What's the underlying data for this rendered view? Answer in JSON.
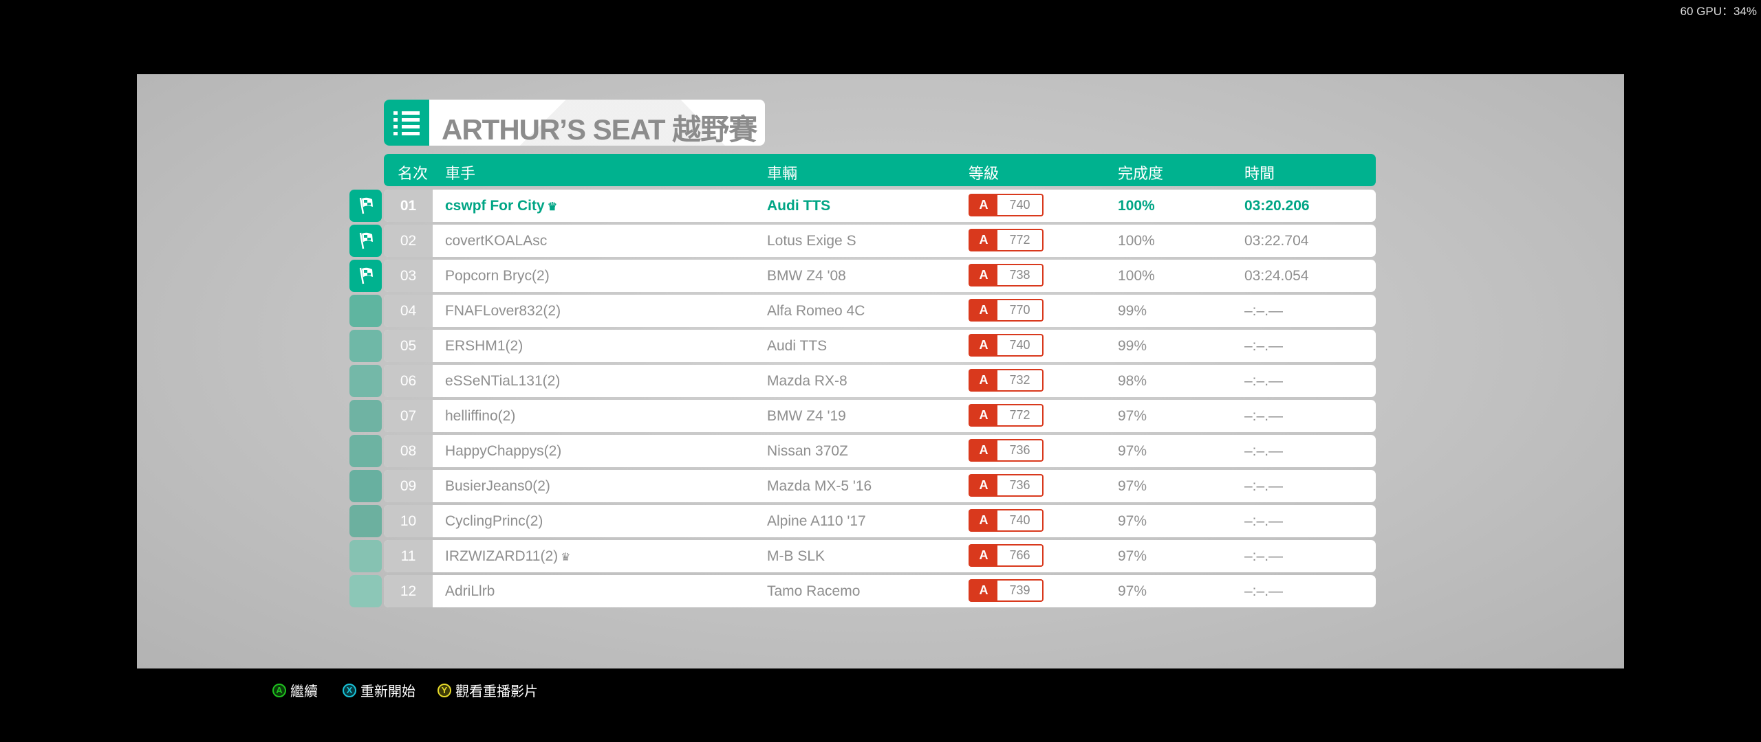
{
  "overlay": {
    "fps": "60 GPU：34%"
  },
  "event": {
    "title": "ARTHUR’S SEAT 越野賽"
  },
  "columns": {
    "rank": "名次",
    "driver": "車手",
    "car": "車輛",
    "class": "等級",
    "completion": "完成度",
    "time": "時間"
  },
  "colors": {
    "accent": "#00b28f",
    "class_a": "#d9391d"
  },
  "rows": [
    {
      "rank": "01",
      "driver": "cswpf For City",
      "crown": true,
      "car": "Audi TTS",
      "cls": "A",
      "pi": "740",
      "completion": "100%",
      "time": "03:20.206",
      "finished": true,
      "me": true
    },
    {
      "rank": "02",
      "driver": "covertKOALAsc",
      "crown": false,
      "car": "Lotus Exige S",
      "cls": "A",
      "pi": "772",
      "completion": "100%",
      "time": "03:22.704",
      "finished": true
    },
    {
      "rank": "03",
      "driver": "Popcorn Bryc(2)",
      "crown": false,
      "car": "BMW Z4 '08",
      "cls": "A",
      "pi": "738",
      "completion": "100%",
      "time": "03:24.054",
      "finished": true
    },
    {
      "rank": "04",
      "driver": "FNAFLover832(2)",
      "crown": false,
      "car": "Alfa Romeo 4C",
      "cls": "A",
      "pi": "770",
      "completion": "99%",
      "time": "–:–.—"
    },
    {
      "rank": "05",
      "driver": "ERSHM1(2)",
      "crown": false,
      "car": "Audi TTS",
      "cls": "A",
      "pi": "740",
      "completion": "99%",
      "time": "–:–.—"
    },
    {
      "rank": "06",
      "driver": "eSSeNTiaL131(2)",
      "crown": false,
      "car": "Mazda RX-8",
      "cls": "A",
      "pi": "732",
      "completion": "98%",
      "time": "–:–.—"
    },
    {
      "rank": "07",
      "driver": "helliffino(2)",
      "crown": false,
      "car": "BMW Z4 '19",
      "cls": "A",
      "pi": "772",
      "completion": "97%",
      "time": "–:–.—"
    },
    {
      "rank": "08",
      "driver": "HappyChappys(2)",
      "crown": false,
      "car": "Nissan 370Z",
      "cls": "A",
      "pi": "736",
      "completion": "97%",
      "time": "–:–.—"
    },
    {
      "rank": "09",
      "driver": "BusierJeans0(2)",
      "crown": false,
      "car": "Mazda MX-5 '16",
      "cls": "A",
      "pi": "736",
      "completion": "97%",
      "time": "–:–.—"
    },
    {
      "rank": "10",
      "driver": "CyclingPrinc(2)",
      "crown": false,
      "car": "Alpine A110 '17",
      "cls": "A",
      "pi": "740",
      "completion": "97%",
      "time": "–:–.—"
    },
    {
      "rank": "11",
      "driver": "IRZWIZARD11(2)",
      "crown": true,
      "car": "M-B SLK",
      "cls": "A",
      "pi": "766",
      "completion": "97%",
      "time": "–:–.—"
    },
    {
      "rank": "12",
      "driver": "AdriLlrb",
      "crown": false,
      "car": "Tamo Racemo",
      "cls": "A",
      "pi": "739",
      "completion": "97%",
      "time": "–:–.—"
    }
  ],
  "footer": [
    {
      "key": "A",
      "label": "繼續",
      "color": "#1fc21f",
      "fill": "#0a3a0a"
    },
    {
      "key": "X",
      "label": "重新開始",
      "color": "#19c3d8",
      "fill": "#063a40"
    },
    {
      "key": "Y",
      "label": "觀看重播影片",
      "color": "#e5d92a",
      "fill": "#3d3a08"
    }
  ]
}
